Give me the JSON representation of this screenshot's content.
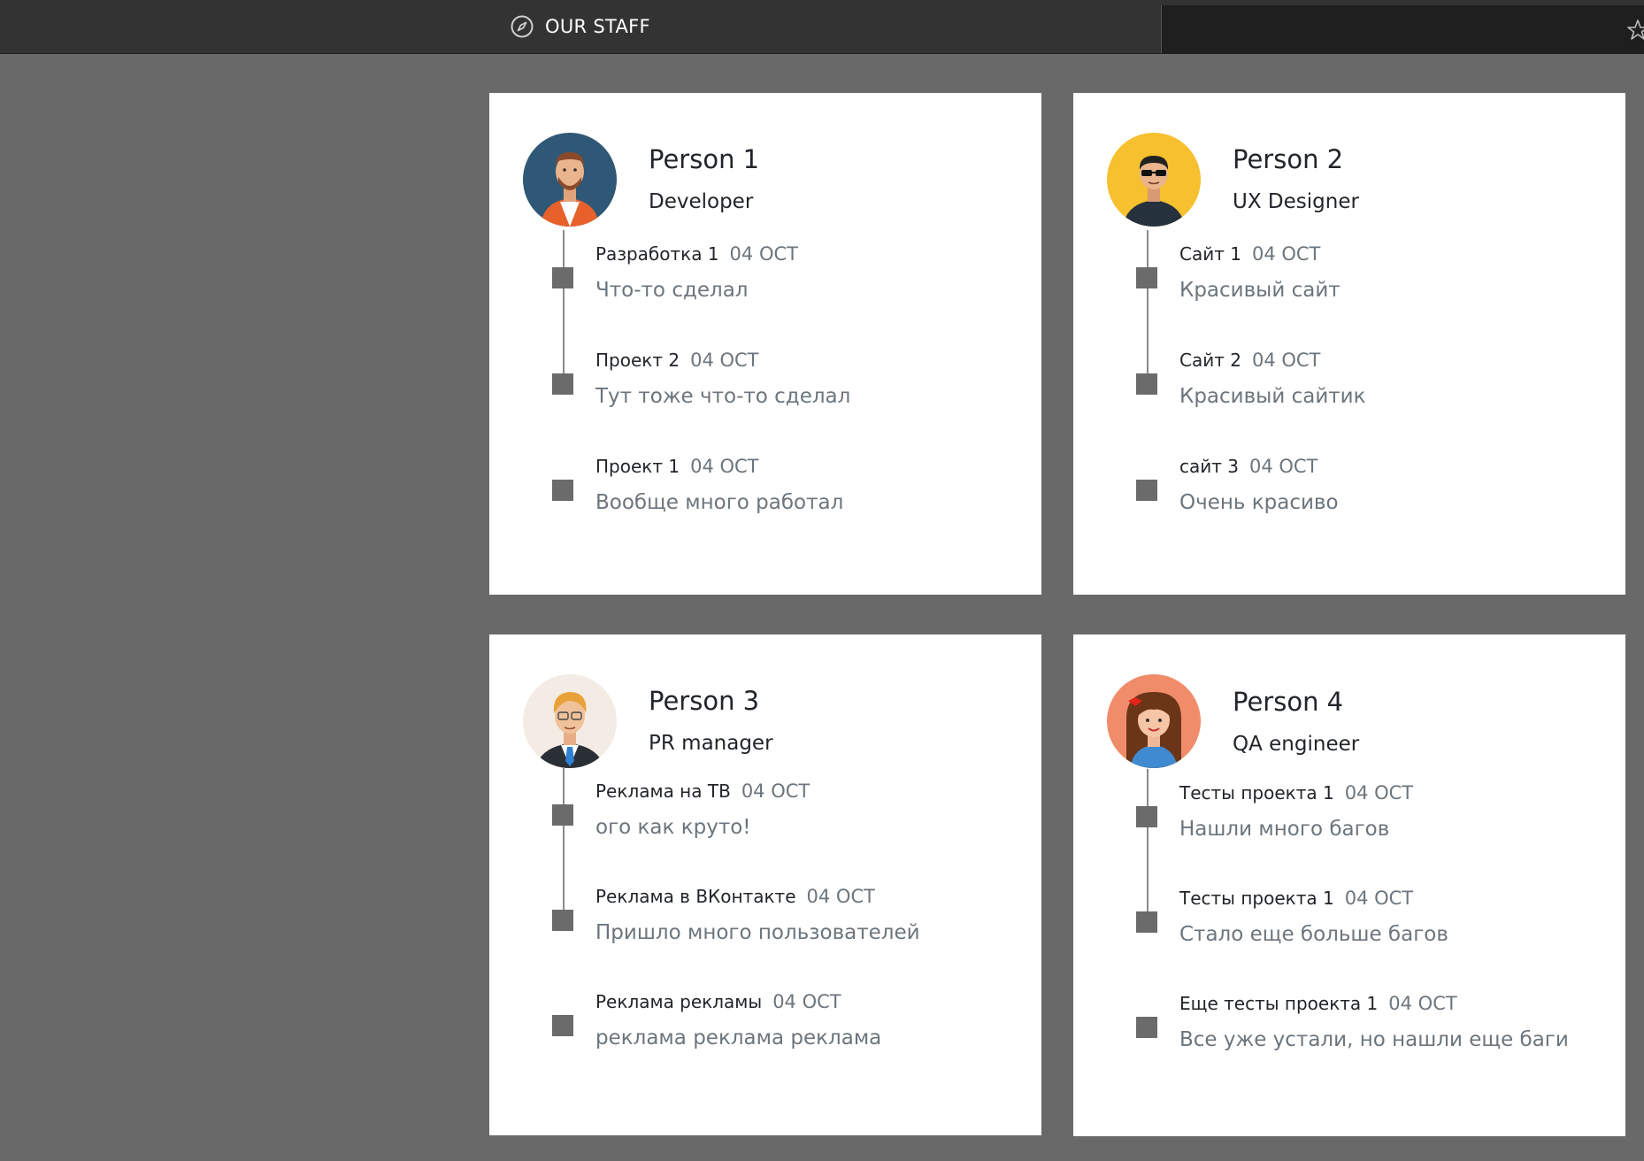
{
  "nav": {
    "title": "OUR STAFF",
    "icon": "compass-icon",
    "right_icon": "star-icon"
  },
  "colors": {
    "page_bg": "#696969",
    "topbar_bg": "#333333",
    "card_bg": "#ffffff",
    "marker": "#6b6b6b",
    "muted_text": "#6c757d"
  },
  "people": [
    {
      "name": "Person 1",
      "role": "Developer",
      "avatar": "developer-avatar-icon",
      "entries": [
        {
          "title": "Разработка 1",
          "date": "04 OCT",
          "text": "Что-то сделал"
        },
        {
          "title": "Проект 2",
          "date": "04 OCT",
          "text": "Тут тоже что-то сделал"
        },
        {
          "title": "Проект 1",
          "date": "04 OCT",
          "text": "Вообще много работал"
        }
      ]
    },
    {
      "name": "Person 2",
      "role": "UX Designer",
      "avatar": "designer-avatar-icon",
      "entries": [
        {
          "title": "Сайт 1",
          "date": "04 OCT",
          "text": "Красивый сайт"
        },
        {
          "title": "Сайт 2",
          "date": "04 OCT",
          "text": "Красивый сайтик"
        },
        {
          "title": "сайт 3",
          "date": "04 OCT",
          "text": "Очень красиво"
        }
      ]
    },
    {
      "name": "Person 3",
      "role": "PR manager",
      "avatar": "manager-avatar-icon",
      "entries": [
        {
          "title": "Реклама на ТВ",
          "date": "04 OCT",
          "text": "ого как круто!"
        },
        {
          "title": "Реклама в ВКонтакте",
          "date": "04 OCT",
          "text": "Пришло много пользователей"
        },
        {
          "title": "Реклама рекламы",
          "date": "04 OCT",
          "text": "реклама реклама реклама"
        }
      ]
    },
    {
      "name": "Person 4",
      "role": "QA engineer",
      "avatar": "qa-avatar-icon",
      "entries": [
        {
          "title": "Тесты проекта 1",
          "date": "04 OCT",
          "text": "Нашли много багов"
        },
        {
          "title": "Тесты проекта 1",
          "date": "04 OCT",
          "text": "Стало еще больше багов"
        },
        {
          "title": "Еще тесты проекта 1",
          "date": "04 OCT",
          "text": "Все уже устали, но нашли еще баги"
        }
      ]
    }
  ]
}
